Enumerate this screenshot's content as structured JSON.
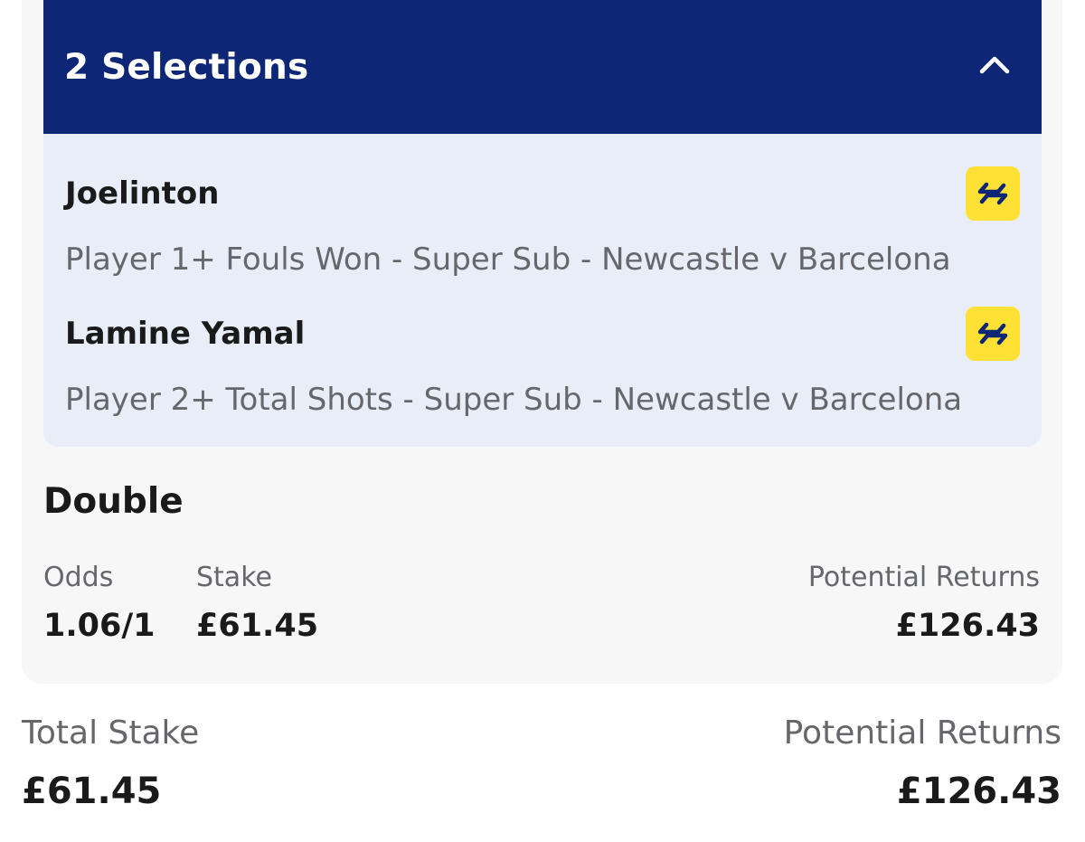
{
  "header": {
    "title": "2 Selections",
    "collapse_icon": "chevron-up-icon",
    "bg_color": "#0d2675"
  },
  "selections": [
    {
      "name": "Joelinton",
      "description": "Player 1+ Fouls Won - Super Sub - Newcastle v Barcelona",
      "icon": "swap-arrows-icon"
    },
    {
      "name": "Lamine Yamal",
      "description": "Player 2+ Total Shots - Super Sub - Newcastle v Barcelona",
      "icon": "swap-arrows-icon"
    }
  ],
  "bet": {
    "type": "Double",
    "odds_label": "Odds",
    "odds_value": "1.06/1",
    "stake_label": "Stake",
    "stake_value": "£61.45",
    "returns_label": "Potential Returns",
    "returns_value": "£126.43"
  },
  "totals": {
    "stake_label": "Total Stake",
    "stake_value": "£61.45",
    "returns_label": "Potential Returns",
    "returns_value": "£126.43"
  },
  "colors": {
    "swap_badge": "#ffe135",
    "selection_bg": "#e8edf8"
  }
}
